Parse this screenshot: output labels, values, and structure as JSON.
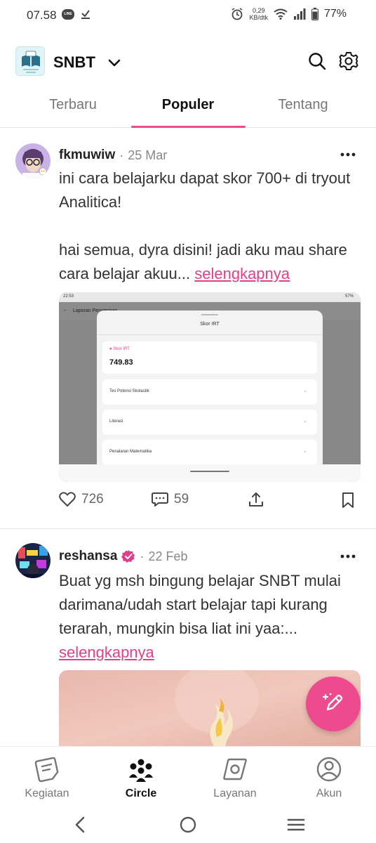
{
  "status_bar": {
    "time": "07.58",
    "line_badge": "LINE",
    "net_speed_value": "0,29",
    "net_speed_unit": "KB/dtk",
    "battery": "77%",
    "icons": [
      "line-icon",
      "download-done-icon",
      "alarm-icon",
      "wifi-icon",
      "signal-icon",
      "battery-icon"
    ]
  },
  "header": {
    "title": "SNBT",
    "logo_text": "SNBT"
  },
  "tabs": [
    {
      "label": "Terbaru",
      "active": false
    },
    {
      "label": "Populer",
      "active": true
    },
    {
      "label": "Tentang",
      "active": false
    }
  ],
  "posts": [
    {
      "author": "fkmuwiw",
      "separator": "·",
      "date": "25 Mar",
      "verified": false,
      "body_line1": "ini cara belajarku dapat skor 700+ di tryout Analitica!",
      "body_line2": "hai semua, dyra disini! jadi aku mau share cara belajar akuu...",
      "more_label": "selengkapnya",
      "likes": "726",
      "comments": "59",
      "screenshot": {
        "time": "22:53",
        "battery": "57%",
        "back_title": "Laporan Pengerjaan",
        "sheet_title": "Skor IRT",
        "score_label": "Skor IRT",
        "score_value": "749.83",
        "rows": [
          "Tes Potensi Skolastik",
          "Literasi",
          "Penalaran Matematika"
        ]
      }
    },
    {
      "author": "reshansa",
      "separator": "·",
      "date": "22 Feb",
      "verified": true,
      "body": "Buat yg msh bingung belajar SNBT mulai darimana/udah start belajar tapi kurang terarah, mungkin bisa liat ini yaa:...",
      "more_label": "selengkapnya"
    }
  ],
  "bottom_nav": [
    {
      "label": "Kegiatan",
      "icon": "notes-icon",
      "active": false
    },
    {
      "label": "Circle",
      "icon": "group-icon",
      "active": true
    },
    {
      "label": "Layanan",
      "icon": "services-icon",
      "active": false
    },
    {
      "label": "Akun",
      "icon": "profile-icon",
      "active": false
    }
  ],
  "colors": {
    "accent": "#ec4c8c",
    "link": "#e0418a",
    "verified": "#e23c8f"
  }
}
